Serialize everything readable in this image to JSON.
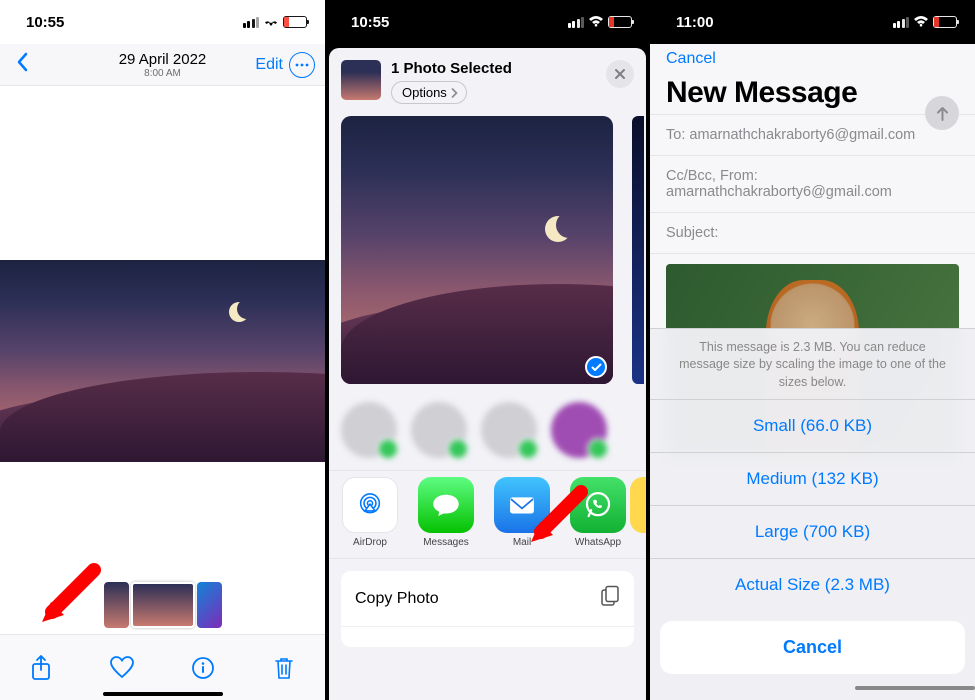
{
  "panel1": {
    "status_time": "10:55",
    "date": "29 April 2022",
    "time": "8:00 AM",
    "edit": "Edit"
  },
  "panel2": {
    "status_time": "10:55",
    "selected": "1 Photo Selected",
    "options": "Options",
    "apps": {
      "airdrop": "AirDrop",
      "messages": "Messages",
      "mail": "Mail",
      "whatsapp": "WhatsApp"
    },
    "copy_photo": "Copy Photo"
  },
  "panel3": {
    "status_time": "11:00",
    "cancel": "Cancel",
    "title": "New Message",
    "to_label": "To:",
    "to_value": "amarnathchakraborty6@gmail.com",
    "ccbcc_label": "Cc/Bcc, From:",
    "from_value": "amarnathchakraborty6@gmail.com",
    "subject_label": "Subject:",
    "msg_info": "This message is 2.3 MB. You can reduce message size by scaling the image to one of the sizes below.",
    "small": "Small (66.0 KB)",
    "medium": "Medium (132 KB)",
    "large": "Large (700 KB)",
    "actual": "Actual Size (2.3 MB)",
    "cancel_btn": "Cancel"
  }
}
